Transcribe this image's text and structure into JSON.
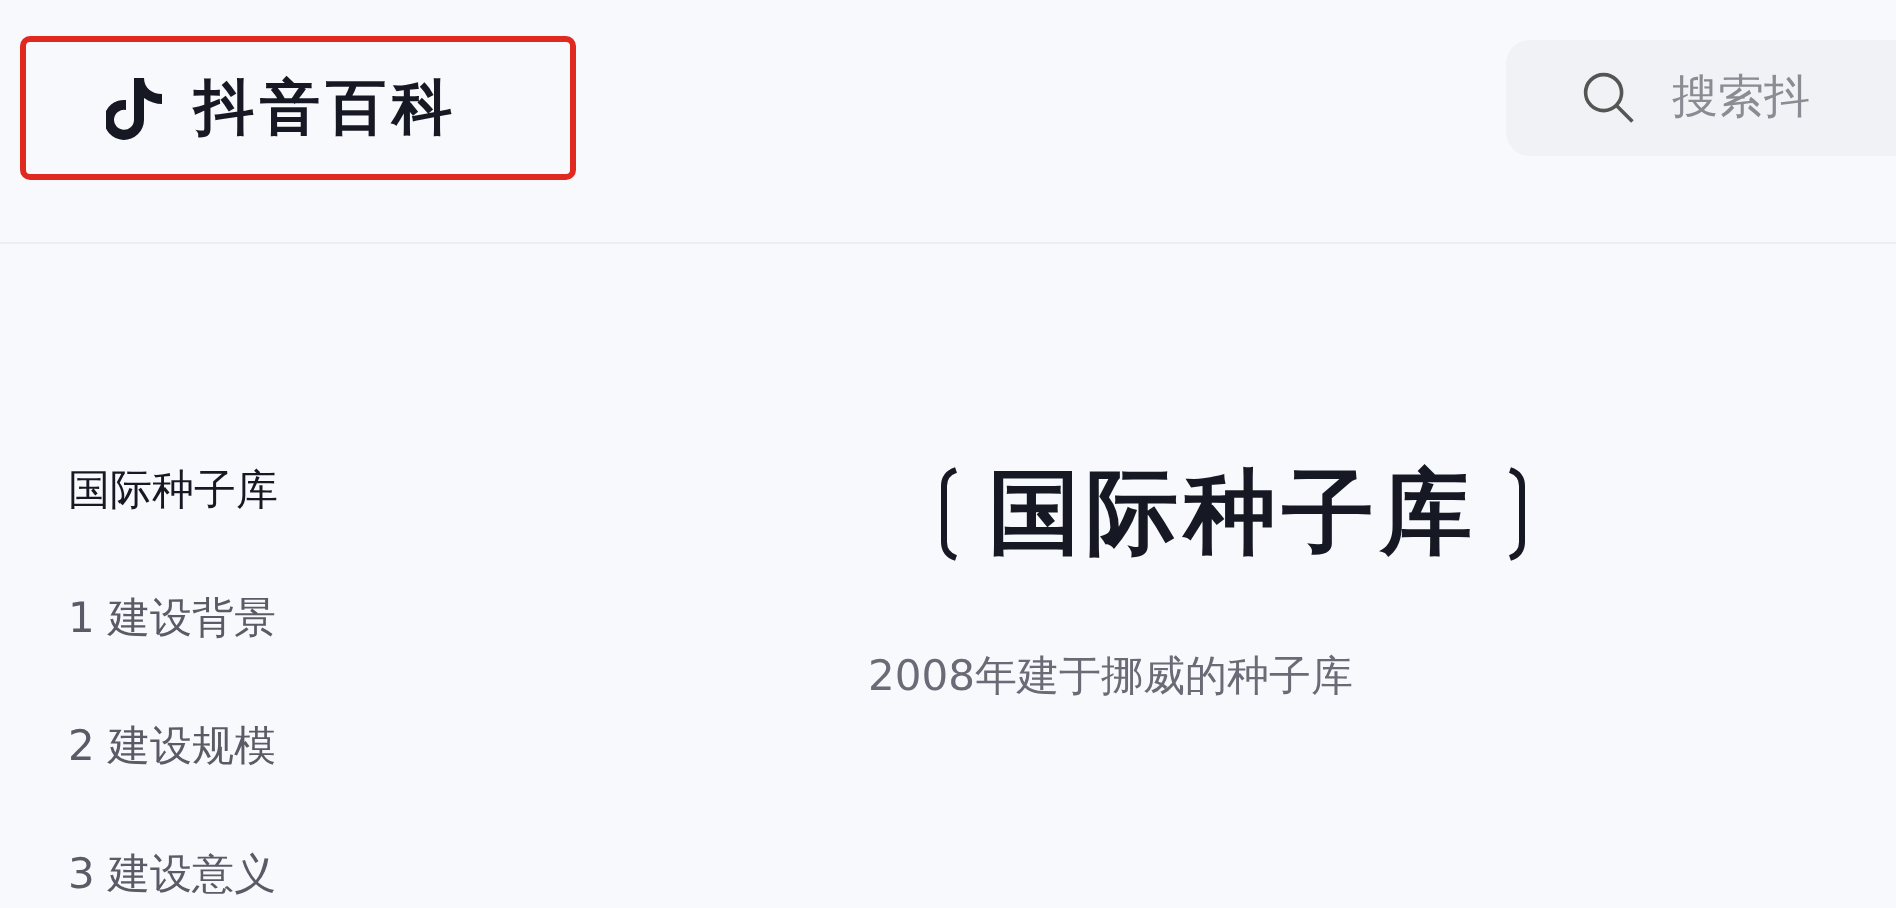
{
  "header": {
    "logo_text": "抖音百科",
    "logo_highlighted": true,
    "search": {
      "placeholder": "搜索抖"
    }
  },
  "toc": {
    "items": [
      {
        "label": "国际种子库",
        "selected": true
      },
      {
        "label": "1 建设背景",
        "selected": false
      },
      {
        "label": "2 建设规模",
        "selected": false
      },
      {
        "label": "3 建设意义",
        "selected": false
      }
    ]
  },
  "article": {
    "title": "国际种子库",
    "summary": "2008年建于挪威的种子库"
  }
}
